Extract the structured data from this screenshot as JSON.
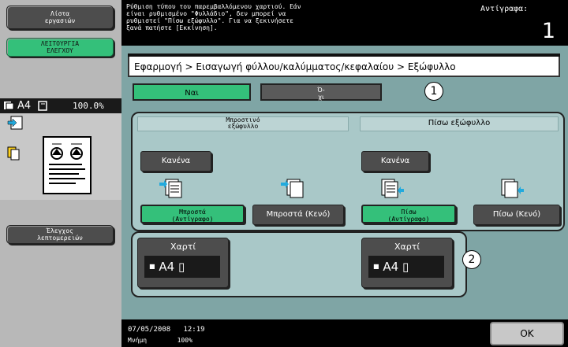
{
  "left": {
    "jobs_button": "Λίστα\nεργασιών",
    "func_button": "ΛΕΙΤΟΥΡΓΙΑ\nΕΛΕΓΧΟΥ",
    "details_button": "Έλεγχος\nλεπτομερειών",
    "paper": "A4",
    "zoom": "100.0%"
  },
  "topbar": {
    "message": "Ρύθμιση τύπου του παρεμβαλλόμενου χαρτιού. Εάν\nείναι ρυθμισμένο \"Φυλλάδιο\", δεν μπορεί να\nρυθμιστεί \"Πίσω εξώφυλλο\". Για να ξεκινήσετε\nξανά πατήστε [Εκκίνηση].",
    "copies_label": "Αντίγραφα:",
    "copies_value": "1"
  },
  "breadcrumb": "Εφαρμογή > Εισαγωγή φύλλου/καλύμματος/κεφαλαίου > Εξώφυλλο",
  "tabs": {
    "yes": "Ναι",
    "no": "Ό-\nχι"
  },
  "callouts": [
    "1",
    "2"
  ],
  "front": {
    "header": "Μπροστινό\nεξώφυλλο",
    "none_label": "Κανένα",
    "copy_label": "Μπροστά\n(Αντίγραφο)",
    "blank_label": "Μπροστά (Κενό)",
    "paper_label": "Χαρτί",
    "paper_value": "A4"
  },
  "back": {
    "header": "Πίσω εξώφυλλο",
    "none_label": "Κανένα",
    "copy_label": "Πίσω\n(Αντίγραφο)",
    "blank_label": "Πίσω (Κενό)",
    "paper_label": "Χαρτί",
    "paper_value": "A4"
  },
  "bottombar": {
    "datetime": "07/05/2008   12:19",
    "memory": "Μνήμη        100%",
    "ok": "OK"
  },
  "colors": {
    "accent_green": "#34c07a",
    "panel_teal": "#7fa5a5",
    "dark_button": "#4d4d4d"
  }
}
